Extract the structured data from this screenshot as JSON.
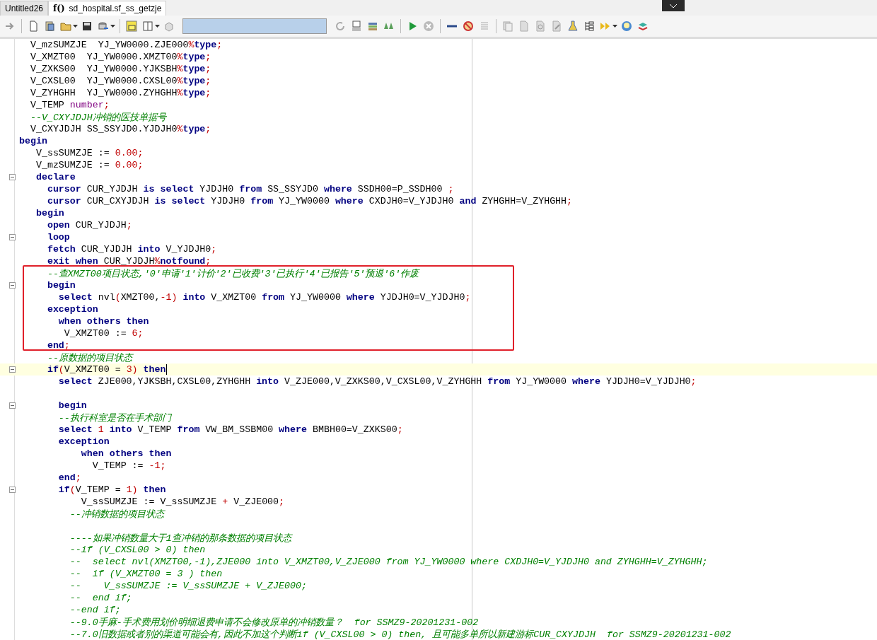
{
  "tabs": [
    {
      "label": "Untitled26",
      "selected": false
    },
    {
      "icon_text": "f()",
      "label": "sd_hospital.sf_ss_getzje",
      "selected": true
    }
  ],
  "editor": {
    "lines": [
      {
        "fold": false,
        "current": false,
        "segments": [
          {
            "kind": "plain",
            "text": "  V_mzSUMZJE  YJ_YW0000.ZJE000"
          },
          {
            "kind": "punct",
            "text": "%"
          },
          {
            "kind": "kw",
            "text": "type"
          },
          {
            "kind": "punct",
            "text": ";"
          }
        ]
      },
      {
        "fold": false,
        "current": false,
        "segments": [
          {
            "kind": "plain",
            "text": "  V_XMZT00  YJ_YW0000.XMZT00"
          },
          {
            "kind": "punct",
            "text": "%"
          },
          {
            "kind": "kw",
            "text": "type"
          },
          {
            "kind": "punct",
            "text": ";"
          }
        ]
      },
      {
        "fold": false,
        "current": false,
        "segments": [
          {
            "kind": "plain",
            "text": "  V_ZXKS00  YJ_YW0000.YJKSBH"
          },
          {
            "kind": "punct",
            "text": "%"
          },
          {
            "kind": "kw",
            "text": "type"
          },
          {
            "kind": "punct",
            "text": ";"
          }
        ]
      },
      {
        "fold": false,
        "current": false,
        "segments": [
          {
            "kind": "plain",
            "text": "  V_CXSL00  YJ_YW0000.CXSL00"
          },
          {
            "kind": "punct",
            "text": "%"
          },
          {
            "kind": "kw",
            "text": "type"
          },
          {
            "kind": "punct",
            "text": ";"
          }
        ]
      },
      {
        "fold": false,
        "current": false,
        "segments": [
          {
            "kind": "plain",
            "text": "  V_ZYHGHH  YJ_YW0000.ZYHGHH"
          },
          {
            "kind": "punct",
            "text": "%"
          },
          {
            "kind": "kw",
            "text": "type"
          },
          {
            "kind": "punct",
            "text": ";"
          }
        ]
      },
      {
        "fold": false,
        "current": false,
        "segments": [
          {
            "kind": "plain",
            "text": "  V_TEMP "
          },
          {
            "kind": "type",
            "text": "number"
          },
          {
            "kind": "punct",
            "text": ";"
          }
        ]
      },
      {
        "fold": false,
        "current": false,
        "segments": [
          {
            "kind": "comment",
            "text": "  --V_CXYJDJH冲销的医技单据号"
          }
        ]
      },
      {
        "fold": false,
        "current": false,
        "segments": [
          {
            "kind": "plain",
            "text": "  V_CXYJDJH SS_SSYJD0.YJDJH0"
          },
          {
            "kind": "punct",
            "text": "%"
          },
          {
            "kind": "kw",
            "text": "type"
          },
          {
            "kind": "punct",
            "text": ";"
          }
        ]
      },
      {
        "fold": false,
        "current": false,
        "segments": [
          {
            "kind": "kw",
            "text": "begin"
          }
        ]
      },
      {
        "fold": false,
        "current": false,
        "segments": [
          {
            "kind": "plain",
            "text": "   V_ssSUMZJE := "
          },
          {
            "kind": "punct",
            "text": "0.00;"
          }
        ]
      },
      {
        "fold": false,
        "current": false,
        "segments": [
          {
            "kind": "plain",
            "text": "   V_mzSUMZJE := "
          },
          {
            "kind": "punct",
            "text": "0.00;"
          }
        ]
      },
      {
        "fold": true,
        "current": false,
        "segments": [
          {
            "kind": "kw",
            "text": "   declare"
          }
        ]
      },
      {
        "fold": false,
        "current": false,
        "segments": [
          {
            "kind": "kw",
            "text": "     cursor"
          },
          {
            "kind": "plain",
            "text": " CUR_YJDJH "
          },
          {
            "kind": "kw",
            "text": "is select"
          },
          {
            "kind": "plain",
            "text": " YJDJH0 "
          },
          {
            "kind": "kw",
            "text": "from"
          },
          {
            "kind": "plain",
            "text": " SS_SSYJD0 "
          },
          {
            "kind": "kw",
            "text": "where"
          },
          {
            "kind": "plain",
            "text": " SSDH00=P_SSDH00 "
          },
          {
            "kind": "punct",
            "text": ";"
          }
        ]
      },
      {
        "fold": false,
        "current": false,
        "segments": [
          {
            "kind": "kw",
            "text": "     cursor"
          },
          {
            "kind": "plain",
            "text": " CUR_CXYJDJH "
          },
          {
            "kind": "kw",
            "text": "is select"
          },
          {
            "kind": "plain",
            "text": " YJDJH0 "
          },
          {
            "kind": "kw",
            "text": "from"
          },
          {
            "kind": "plain",
            "text": " YJ_YW0000 "
          },
          {
            "kind": "kw",
            "text": "where"
          },
          {
            "kind": "plain",
            "text": " CXDJH0=V_YJDJH0 "
          },
          {
            "kind": "kw",
            "text": "and"
          },
          {
            "kind": "plain",
            "text": " ZYHGHH=V_ZYHGHH"
          },
          {
            "kind": "punct",
            "text": ";"
          }
        ]
      },
      {
        "fold": false,
        "current": false,
        "segments": [
          {
            "kind": "kw",
            "text": "   begin"
          }
        ]
      },
      {
        "fold": false,
        "current": false,
        "segments": [
          {
            "kind": "kw",
            "text": "     open"
          },
          {
            "kind": "plain",
            "text": " CUR_YJDJH"
          },
          {
            "kind": "punct",
            "text": ";"
          }
        ]
      },
      {
        "fold": true,
        "current": false,
        "segments": [
          {
            "kind": "kw",
            "text": "     loop"
          }
        ]
      },
      {
        "fold": false,
        "current": false,
        "segments": [
          {
            "kind": "kw",
            "text": "     fetch"
          },
          {
            "kind": "plain",
            "text": " CUR_YJDJH "
          },
          {
            "kind": "kw",
            "text": "into"
          },
          {
            "kind": "plain",
            "text": " V_YJDJH0"
          },
          {
            "kind": "punct",
            "text": ";"
          }
        ]
      },
      {
        "fold": false,
        "current": false,
        "segments": [
          {
            "kind": "kw",
            "text": "     exit when"
          },
          {
            "kind": "plain",
            "text": " CUR_YJDJH"
          },
          {
            "kind": "punct",
            "text": "%"
          },
          {
            "kind": "kw",
            "text": "notfound"
          },
          {
            "kind": "punct",
            "text": ";"
          }
        ]
      },
      {
        "fold": false,
        "current": false,
        "segments": [
          {
            "kind": "comment",
            "text": "     --查XMZT00项目状态,'0'申请'1'计价'2'已收费'3'已执行'4'已报告'5'预退'6'作废"
          }
        ]
      },
      {
        "fold": true,
        "current": false,
        "segments": [
          {
            "kind": "kw",
            "text": "     begin"
          }
        ]
      },
      {
        "fold": false,
        "current": false,
        "segments": [
          {
            "kind": "kw",
            "text": "       select"
          },
          {
            "kind": "plain",
            "text": " nvl"
          },
          {
            "kind": "punct",
            "text": "("
          },
          {
            "kind": "plain",
            "text": "XMZT00,"
          },
          {
            "kind": "punct",
            "text": "-1)"
          },
          {
            "kind": "kw",
            "text": " into"
          },
          {
            "kind": "plain",
            "text": " V_XMZT00 "
          },
          {
            "kind": "kw",
            "text": "from"
          },
          {
            "kind": "plain",
            "text": " YJ_YW0000 "
          },
          {
            "kind": "kw",
            "text": "where"
          },
          {
            "kind": "plain",
            "text": " YJDJH0=V_YJDJH0"
          },
          {
            "kind": "punct",
            "text": ";"
          }
        ]
      },
      {
        "fold": false,
        "current": false,
        "segments": [
          {
            "kind": "kw",
            "text": "     exception"
          }
        ]
      },
      {
        "fold": false,
        "current": false,
        "segments": [
          {
            "kind": "kw",
            "text": "       when others then"
          }
        ]
      },
      {
        "fold": false,
        "current": false,
        "segments": [
          {
            "kind": "plain",
            "text": "        V_XMZT00 := "
          },
          {
            "kind": "punct",
            "text": "6;"
          }
        ]
      },
      {
        "fold": false,
        "current": false,
        "segments": [
          {
            "kind": "kw",
            "text": "     end"
          },
          {
            "kind": "punct",
            "text": ";"
          }
        ]
      },
      {
        "fold": false,
        "current": false,
        "segments": [
          {
            "kind": "comment",
            "text": "     --原数据的项目状态"
          }
        ]
      },
      {
        "fold": true,
        "current": true,
        "segments": [
          {
            "kind": "kw",
            "text": "     if"
          },
          {
            "kind": "punct",
            "text": "("
          },
          {
            "kind": "plain",
            "text": "V_XMZT00 = "
          },
          {
            "kind": "punct",
            "text": "3)"
          },
          {
            "kind": "kw",
            "text": " then"
          }
        ]
      },
      {
        "fold": false,
        "current": false,
        "segments": [
          {
            "kind": "kw",
            "text": "       select"
          },
          {
            "kind": "plain",
            "text": " ZJE000,YJKSBH,CXSL00,ZYHGHH "
          },
          {
            "kind": "kw",
            "text": "into"
          },
          {
            "kind": "plain",
            "text": " V_ZJE000,V_ZXKS00,V_CXSL00,V_ZYHGHH "
          },
          {
            "kind": "kw",
            "text": "from"
          },
          {
            "kind": "plain",
            "text": " YJ_YW0000 "
          },
          {
            "kind": "kw",
            "text": "where"
          },
          {
            "kind": "plain",
            "text": " YJDJH0=V_YJDJH0"
          },
          {
            "kind": "punct",
            "text": ";"
          }
        ]
      },
      {
        "fold": false,
        "current": false
      },
      {
        "fold": true,
        "current": false,
        "segments": [
          {
            "kind": "kw",
            "text": "       begin"
          }
        ]
      },
      {
        "fold": false,
        "current": false,
        "segments": [
          {
            "kind": "comment",
            "text": "       --执行科室是否在手术部门"
          }
        ]
      },
      {
        "fold": false,
        "current": false,
        "segments": [
          {
            "kind": "kw",
            "text": "       select"
          },
          {
            "kind": "punct",
            "text": " 1"
          },
          {
            "kind": "kw",
            "text": " into"
          },
          {
            "kind": "plain",
            "text": " V_TEMP "
          },
          {
            "kind": "kw",
            "text": "from"
          },
          {
            "kind": "plain",
            "text": " VW_BM_SSBM00 "
          },
          {
            "kind": "kw",
            "text": "where"
          },
          {
            "kind": "plain",
            "text": " BMBH00=V_ZXKS00"
          },
          {
            "kind": "punct",
            "text": ";"
          }
        ]
      },
      {
        "fold": false,
        "current": false,
        "segments": [
          {
            "kind": "kw",
            "text": "       exception"
          }
        ]
      },
      {
        "fold": false,
        "current": false,
        "segments": [
          {
            "kind": "kw",
            "text": "           when others then"
          }
        ]
      },
      {
        "fold": false,
        "current": false,
        "segments": [
          {
            "kind": "plain",
            "text": "             V_TEMP := "
          },
          {
            "kind": "punct",
            "text": "-1;"
          }
        ]
      },
      {
        "fold": false,
        "current": false,
        "segments": [
          {
            "kind": "kw",
            "text": "       end"
          },
          {
            "kind": "punct",
            "text": ";"
          }
        ]
      },
      {
        "fold": true,
        "current": false,
        "segments": [
          {
            "kind": "kw",
            "text": "       if"
          },
          {
            "kind": "punct",
            "text": "("
          },
          {
            "kind": "plain",
            "text": "V_TEMP = "
          },
          {
            "kind": "punct",
            "text": "1)"
          },
          {
            "kind": "kw",
            "text": " then"
          }
        ]
      },
      {
        "fold": false,
        "current": false,
        "segments": [
          {
            "kind": "plain",
            "text": "           V_ssSUMZJE := V_ssSUMZJE "
          },
          {
            "kind": "punct",
            "text": "+"
          },
          {
            "kind": "plain",
            "text": " V_ZJE000"
          },
          {
            "kind": "punct",
            "text": ";"
          }
        ]
      },
      {
        "fold": false,
        "current": false,
        "segments": [
          {
            "kind": "comment",
            "text": "         --冲销数据的项目状态"
          }
        ]
      },
      {
        "fold": false,
        "current": false
      },
      {
        "fold": false,
        "current": false,
        "segments": [
          {
            "kind": "comment",
            "text": "         ----如果冲销数量大于1查冲销的那条数据的项目状态"
          }
        ]
      },
      {
        "fold": false,
        "current": false,
        "segments": [
          {
            "kind": "comment",
            "text": "         --if (V_CXSL00 > 0) then"
          }
        ]
      },
      {
        "fold": false,
        "current": false,
        "segments": [
          {
            "kind": "comment",
            "text": "         --  select nvl(XMZT00,-1),ZJE000 into V_XMZT00,V_ZJE000 from YJ_YW0000 where CXDJH0=V_YJDJH0 and ZYHGHH=V_ZYHGHH;"
          }
        ]
      },
      {
        "fold": false,
        "current": false,
        "segments": [
          {
            "kind": "comment",
            "text": "         --  if (V_XMZT00 = 3 ) then"
          }
        ]
      },
      {
        "fold": false,
        "current": false,
        "segments": [
          {
            "kind": "comment",
            "text": "         --    V_ssSUMZJE := V_ssSUMZJE + V_ZJE000;"
          }
        ]
      },
      {
        "fold": false,
        "current": false,
        "segments": [
          {
            "kind": "comment",
            "text": "         --  end if;"
          }
        ]
      },
      {
        "fold": false,
        "current": false,
        "segments": [
          {
            "kind": "comment",
            "text": "         --end if;"
          }
        ]
      },
      {
        "fold": false,
        "current": false,
        "segments": [
          {
            "kind": "comment",
            "text": "         --9.0手麻-手术费用划价明细退费申请不会修改原单的冲销数量？  for SSMZ9-20201231-002"
          }
        ]
      },
      {
        "fold": false,
        "current": false,
        "segments": [
          {
            "kind": "comment",
            "text": "         --7.0旧数据或者别的渠道可能会有,因此不加这个判断if (V_CXSL00 > 0) then, 且可能多单所以新建游标CUR_CXYJDJH  for SSMZ9-20201231-002"
          }
        ]
      }
    ]
  }
}
